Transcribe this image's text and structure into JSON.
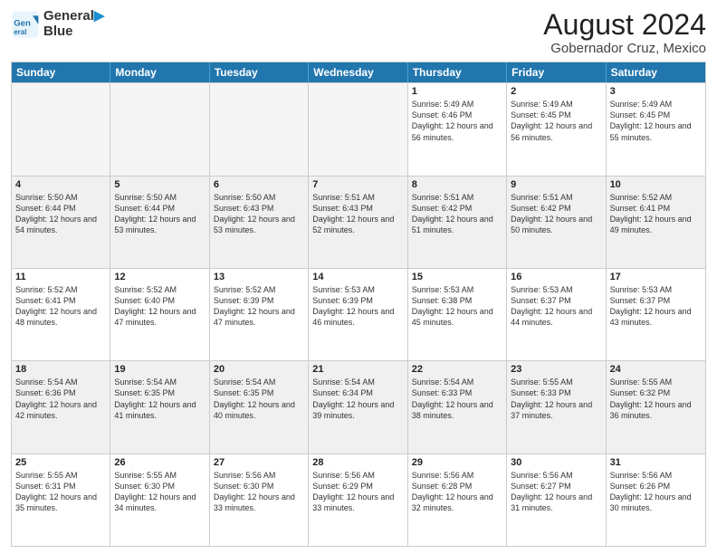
{
  "logo": {
    "line1": "General",
    "line2": "Blue"
  },
  "title": "August 2024",
  "subtitle": "Gobernador Cruz, Mexico",
  "days_of_week": [
    "Sunday",
    "Monday",
    "Tuesday",
    "Wednesday",
    "Thursday",
    "Friday",
    "Saturday"
  ],
  "weeks": [
    [
      {
        "day": "",
        "empty": true
      },
      {
        "day": "",
        "empty": true
      },
      {
        "day": "",
        "empty": true
      },
      {
        "day": "",
        "empty": true
      },
      {
        "day": "1",
        "sunrise": "5:49 AM",
        "sunset": "6:46 PM",
        "daylight": "12 hours and 56 minutes."
      },
      {
        "day": "2",
        "sunrise": "5:49 AM",
        "sunset": "6:45 PM",
        "daylight": "12 hours and 56 minutes."
      },
      {
        "day": "3",
        "sunrise": "5:49 AM",
        "sunset": "6:45 PM",
        "daylight": "12 hours and 55 minutes."
      }
    ],
    [
      {
        "day": "4",
        "sunrise": "5:50 AM",
        "sunset": "6:44 PM",
        "daylight": "12 hours and 54 minutes."
      },
      {
        "day": "5",
        "sunrise": "5:50 AM",
        "sunset": "6:44 PM",
        "daylight": "12 hours and 53 minutes."
      },
      {
        "day": "6",
        "sunrise": "5:50 AM",
        "sunset": "6:43 PM",
        "daylight": "12 hours and 53 minutes."
      },
      {
        "day": "7",
        "sunrise": "5:51 AM",
        "sunset": "6:43 PM",
        "daylight": "12 hours and 52 minutes."
      },
      {
        "day": "8",
        "sunrise": "5:51 AM",
        "sunset": "6:42 PM",
        "daylight": "12 hours and 51 minutes."
      },
      {
        "day": "9",
        "sunrise": "5:51 AM",
        "sunset": "6:42 PM",
        "daylight": "12 hours and 50 minutes."
      },
      {
        "day": "10",
        "sunrise": "5:52 AM",
        "sunset": "6:41 PM",
        "daylight": "12 hours and 49 minutes."
      }
    ],
    [
      {
        "day": "11",
        "sunrise": "5:52 AM",
        "sunset": "6:41 PM",
        "daylight": "12 hours and 48 minutes."
      },
      {
        "day": "12",
        "sunrise": "5:52 AM",
        "sunset": "6:40 PM",
        "daylight": "12 hours and 47 minutes."
      },
      {
        "day": "13",
        "sunrise": "5:52 AM",
        "sunset": "6:39 PM",
        "daylight": "12 hours and 47 minutes."
      },
      {
        "day": "14",
        "sunrise": "5:53 AM",
        "sunset": "6:39 PM",
        "daylight": "12 hours and 46 minutes."
      },
      {
        "day": "15",
        "sunrise": "5:53 AM",
        "sunset": "6:38 PM",
        "daylight": "12 hours and 45 minutes."
      },
      {
        "day": "16",
        "sunrise": "5:53 AM",
        "sunset": "6:37 PM",
        "daylight": "12 hours and 44 minutes."
      },
      {
        "day": "17",
        "sunrise": "5:53 AM",
        "sunset": "6:37 PM",
        "daylight": "12 hours and 43 minutes."
      }
    ],
    [
      {
        "day": "18",
        "sunrise": "5:54 AM",
        "sunset": "6:36 PM",
        "daylight": "12 hours and 42 minutes."
      },
      {
        "day": "19",
        "sunrise": "5:54 AM",
        "sunset": "6:35 PM",
        "daylight": "12 hours and 41 minutes."
      },
      {
        "day": "20",
        "sunrise": "5:54 AM",
        "sunset": "6:35 PM",
        "daylight": "12 hours and 40 minutes."
      },
      {
        "day": "21",
        "sunrise": "5:54 AM",
        "sunset": "6:34 PM",
        "daylight": "12 hours and 39 minutes."
      },
      {
        "day": "22",
        "sunrise": "5:54 AM",
        "sunset": "6:33 PM",
        "daylight": "12 hours and 38 minutes."
      },
      {
        "day": "23",
        "sunrise": "5:55 AM",
        "sunset": "6:33 PM",
        "daylight": "12 hours and 37 minutes."
      },
      {
        "day": "24",
        "sunrise": "5:55 AM",
        "sunset": "6:32 PM",
        "daylight": "12 hours and 36 minutes."
      }
    ],
    [
      {
        "day": "25",
        "sunrise": "5:55 AM",
        "sunset": "6:31 PM",
        "daylight": "12 hours and 35 minutes."
      },
      {
        "day": "26",
        "sunrise": "5:55 AM",
        "sunset": "6:30 PM",
        "daylight": "12 hours and 34 minutes."
      },
      {
        "day": "27",
        "sunrise": "5:56 AM",
        "sunset": "6:30 PM",
        "daylight": "12 hours and 33 minutes."
      },
      {
        "day": "28",
        "sunrise": "5:56 AM",
        "sunset": "6:29 PM",
        "daylight": "12 hours and 33 minutes."
      },
      {
        "day": "29",
        "sunrise": "5:56 AM",
        "sunset": "6:28 PM",
        "daylight": "12 hours and 32 minutes."
      },
      {
        "day": "30",
        "sunrise": "5:56 AM",
        "sunset": "6:27 PM",
        "daylight": "12 hours and 31 minutes."
      },
      {
        "day": "31",
        "sunrise": "5:56 AM",
        "sunset": "6:26 PM",
        "daylight": "12 hours and 30 minutes."
      }
    ]
  ]
}
